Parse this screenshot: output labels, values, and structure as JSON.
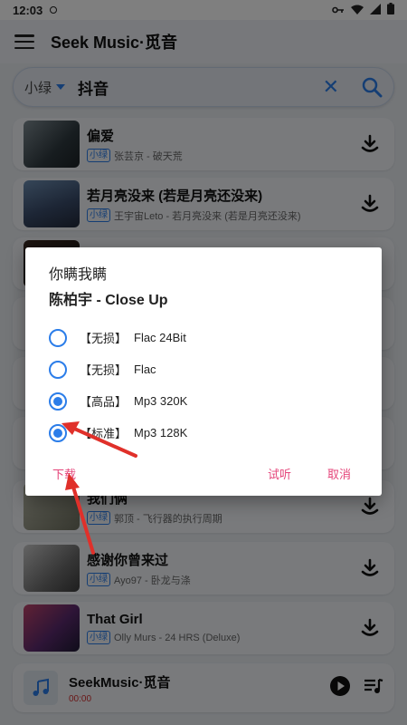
{
  "status": {
    "time": "12:03"
  },
  "app": {
    "title": "Seek Music·觅音"
  },
  "search": {
    "source": "小绿",
    "query": "抖音"
  },
  "songs": [
    {
      "title": "偏爱",
      "badge": "小绿",
      "artist": "张芸京 - 破天荒"
    },
    {
      "title": "若月亮没来 (若是月亮还没来)",
      "badge": "小绿",
      "artist": "王宇宙Leto - 若月亮没来 (若是月亮还没来)"
    },
    {
      "title": "",
      "badge": "",
      "artist": ""
    },
    {
      "title": "我们俩",
      "badge": "小绿",
      "artist": "郭顶 - 飞行器的执行周期"
    },
    {
      "title": "感谢你曾来过",
      "badge": "小绿",
      "artist": "Ayo97 - 卧龙与涤"
    },
    {
      "title": "That Girl",
      "badge": "小绿",
      "artist": "Olly Murs - 24 HRS (Deluxe)"
    }
  ],
  "player": {
    "title": "SeekMusic·觅音",
    "time": "00:00"
  },
  "dialog": {
    "title": "你瞒我瞒",
    "subtitle": "陈柏宇 - Close Up",
    "options": [
      {
        "tag": "【无损】",
        "label": "Flac 24Bit",
        "selected": false
      },
      {
        "tag": "【无损】",
        "label": "Flac",
        "selected": false
      },
      {
        "tag": "【高品】",
        "label": "Mp3 320K",
        "selected": false
      },
      {
        "tag": "【标准】",
        "label": "Mp3 128K",
        "selected": true
      }
    ],
    "actions": {
      "download": "下载",
      "preview": "试听",
      "cancel": "取消"
    }
  },
  "colors": {
    "accent": "#2b7de9",
    "action": "#e5457a",
    "arrow": "#e0302a"
  }
}
